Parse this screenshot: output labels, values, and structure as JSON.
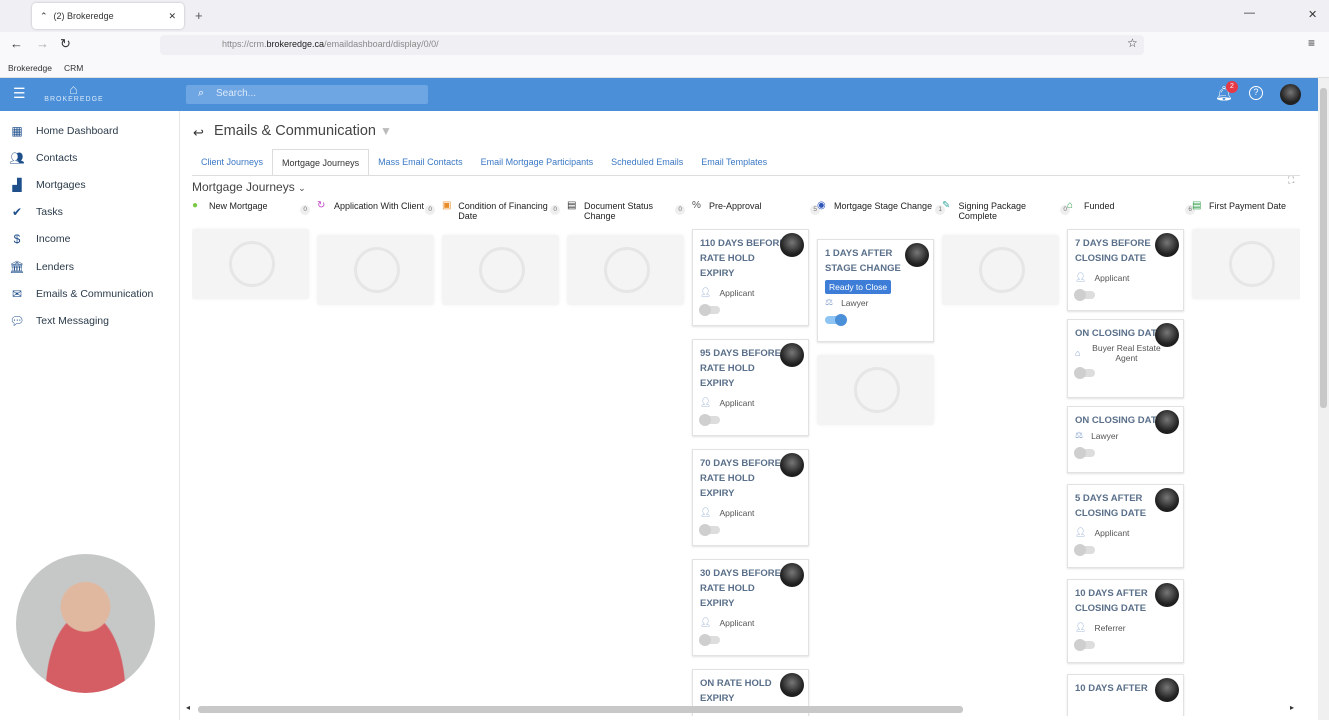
{
  "browser": {
    "tab_title": "(2) Brokeredge",
    "url_prefix": "https://crm.",
    "url_domain": "brokeredge.ca",
    "url_path": "/emaildashboard/display/0/0/",
    "bookmarks": [
      "Brokeredge",
      "CRM"
    ]
  },
  "topbar": {
    "logo": "BROKEREDGE",
    "search_placeholder": "Search...",
    "notifications": "2"
  },
  "sidebar": {
    "items": [
      "Home Dashboard",
      "Contacts",
      "Mortgages",
      "Tasks",
      "Income",
      "Lenders",
      "Emails & Communication",
      "Text Messaging"
    ]
  },
  "page": {
    "title": "Emails & Communication",
    "tabs": [
      "Client Journeys",
      "Mortgage Journeys",
      "Mass Email Contacts",
      "Email Mortgage Participants",
      "Scheduled Emails",
      "Email Templates"
    ],
    "board_title": "Mortgage Journeys"
  },
  "columns": [
    {
      "name": "New Mortgage",
      "count": "0"
    },
    {
      "name": "Application With Client",
      "count": "0"
    },
    {
      "name": "Condition of Financing Date",
      "count": "0"
    },
    {
      "name": "Document Status Change",
      "count": "0"
    },
    {
      "name": "Pre-Approval",
      "count": "5"
    },
    {
      "name": "Mortgage Stage Change",
      "count": "1"
    },
    {
      "name": "Signing Package Complete",
      "count": "0"
    },
    {
      "name": "Funded",
      "count": "6"
    },
    {
      "name": "First Payment Date",
      "count": "0"
    }
  ],
  "preapproval_cards": [
    {
      "title": "110 DAYS BEFORE RATE HOLD EXPIRY",
      "role": "Applicant"
    },
    {
      "title": "95 DAYS BEFORE RATE HOLD EXPIRY",
      "role": "Applicant"
    },
    {
      "title": "70 DAYS BEFORE RATE HOLD EXPIRY",
      "role": "Applicant"
    },
    {
      "title": "30 DAYS BEFORE RATE HOLD EXPIRY",
      "role": "Applicant"
    },
    {
      "title": "ON RATE HOLD EXPIRY",
      "role": ""
    }
  ],
  "stage_card": {
    "title": "1 DAYS AFTER STAGE CHANGE",
    "badge": "Ready to Close",
    "role": "Lawyer"
  },
  "funded_cards": [
    {
      "title": "7 DAYS BEFORE CLOSING DATE",
      "role": "Applicant"
    },
    {
      "title": "ON CLOSING DATE",
      "role": "Buyer Real Estate Agent"
    },
    {
      "title": "ON CLOSING DATE",
      "role": "Lawyer"
    },
    {
      "title": "5 DAYS AFTER CLOSING DATE",
      "role": "Applicant"
    },
    {
      "title": "10 DAYS AFTER CLOSING DATE",
      "role": "Referrer"
    },
    {
      "title": "10 DAYS AFTER",
      "role": ""
    }
  ]
}
